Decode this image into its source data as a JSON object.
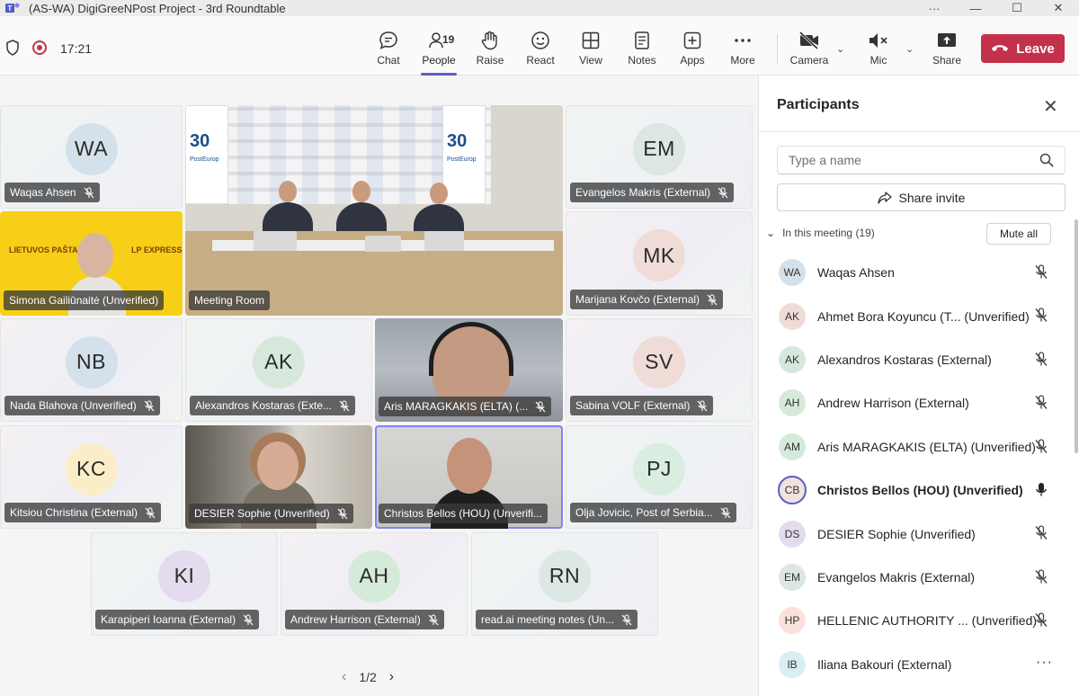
{
  "window": {
    "title": "(AS-WA) DigiGreeNPost Project - 3rd Roundtable"
  },
  "toolbar": {
    "time": "17:21",
    "people_count": "19",
    "buttons": {
      "chat": "Chat",
      "people": "People",
      "raise": "Raise",
      "react": "React",
      "view": "View",
      "notes": "Notes",
      "apps": "Apps",
      "more": "More",
      "camera": "Camera",
      "mic": "Mic",
      "share": "Share"
    },
    "leave": "Leave"
  },
  "tiles": [
    {
      "initials": "WA",
      "name": "Waqas Ahsen",
      "color": "#d4e1ea"
    },
    {
      "name": "Meeting Room"
    },
    {
      "initials": "EM",
      "name": "Evangelos Makris (External)",
      "color": "#dbe7e0"
    },
    {
      "name": "Simona Gailiūnaitė (Unverified)"
    },
    {
      "initials": "MK",
      "name": "Marijana Kovčo (External)",
      "color": "#f0dcd6"
    },
    {
      "initials": "NB",
      "name": "Nada Blahova (Unverified)",
      "color": "#d4e1ea"
    },
    {
      "initials": "AK",
      "name": "Alexandros Kostaras (Exte...",
      "color": "#d6e8db"
    },
    {
      "name": "Aris MARAGKAKIS (ELTA) (..."
    },
    {
      "initials": "SV",
      "name": "Sabina VOLF (External)",
      "color": "#f0dcd6"
    },
    {
      "initials": "KC",
      "name": "Kitsiou Christina (External)",
      "color": "#fbedc7"
    },
    {
      "name": "DESIER Sophie (Unverified)"
    },
    {
      "name": "Christos Bellos (HOU) (Unverifi..."
    },
    {
      "initials": "PJ",
      "name": "Olja Jovicic, Post of Serbia...",
      "color": "#d9ede0"
    },
    {
      "initials": "KI",
      "name": "Karapiperi Ioanna (External)",
      "color": "#e4dcee"
    },
    {
      "initials": "AH",
      "name": "Andrew Harrison (External)",
      "color": "#d6ead9"
    },
    {
      "initials": "RN",
      "name": "read.ai meeting notes (Un...",
      "color": "#dbe8e4"
    }
  ],
  "meeting_room": {
    "banner_big": "30",
    "banner_small": "PostEurop"
  },
  "simona_logos": {
    "left": "LIETUVOS PAŠTAS",
    "right": "LP EXPRESS"
  },
  "pager": {
    "label": "1/2"
  },
  "panel": {
    "title": "Participants",
    "search_placeholder": "Type a name",
    "share_invite": "Share invite",
    "section": "In this meeting (19)",
    "mute_all": "Mute all",
    "participants": [
      {
        "initials": "WA",
        "name": "Waqas Ahsen",
        "color": "#d4e1ea",
        "status": "mic-off"
      },
      {
        "initials": "AK",
        "name": "Ahmet Bora Koyuncu (T... (Unverified)",
        "color": "#f0dcd6",
        "status": "mic-off"
      },
      {
        "initials": "AK",
        "name": "Alexandros Kostaras (External)",
        "color": "#d6e8db",
        "status": "mic-off"
      },
      {
        "initials": "AH",
        "name": "Andrew Harrison (External)",
        "color": "#d6ead9",
        "status": "mic-off"
      },
      {
        "initials": "AM",
        "name": "Aris MARAGKAKIS (ELTA) (Unverified)",
        "color": "#d6ead9",
        "status": "mic-off"
      },
      {
        "initials": "CB",
        "name": "Christos Bellos (HOU) (Unverified)",
        "color": "#f0e2dc",
        "status": "mic-on",
        "speaking": true
      },
      {
        "initials": "DS",
        "name": "DESIER Sophie (Unverified)",
        "color": "#e4dcee",
        "status": "mic-off"
      },
      {
        "initials": "EM",
        "name": "Evangelos Makris (External)",
        "color": "#dbe7e0",
        "status": "mic-off"
      },
      {
        "initials": "HP",
        "name": "HELLENIC AUTHORITY ... (Unverified)",
        "color": "#fbe1dc",
        "status": "mic-off"
      },
      {
        "initials": "IB",
        "name": "Iliana Bakouri (External)",
        "color": "#d9eef0",
        "status": "more"
      }
    ]
  },
  "colors": {
    "accent": "#5b5fc7",
    "leave": "#c4314b"
  }
}
